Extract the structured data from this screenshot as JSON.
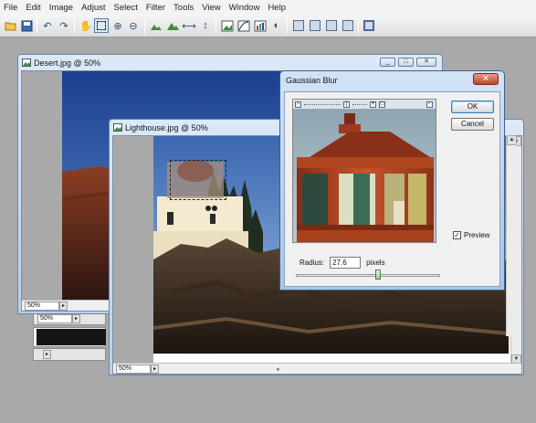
{
  "menu": [
    "File",
    "Edit",
    "Image",
    "Adjust",
    "Select",
    "Filter",
    "Tools",
    "View",
    "Window",
    "Help"
  ],
  "toolbar": {
    "icons": [
      "open-icon",
      "save-icon",
      "undo-icon",
      "redo-icon",
      "hand-tool-icon",
      "marquee-tool-icon",
      "zoom-in-icon",
      "zoom-out-icon",
      "mountain-small-icon",
      "mountain-large-icon",
      "flip-horizontal-icon",
      "flip-vertical-icon",
      "image-adjust-icon",
      "curves-icon",
      "levels-icon",
      "color-balance-icon",
      "frame-1-icon",
      "frame-2-icon",
      "frame-3-icon",
      "frame-4-icon",
      "frame-5-icon"
    ]
  },
  "windows": {
    "desert": {
      "title": "Desert.jpg @ 50%",
      "zoom": "50%"
    },
    "lighthouse": {
      "title": "Lighthouse.jpg @ 50%",
      "zoom": "50%"
    },
    "minimized_1": {
      "zoom": "50%"
    }
  },
  "dialog": {
    "title": "Gaussian Blur",
    "close": "✕",
    "ok_label": "OK",
    "cancel_label": "Cancel",
    "preview_label": "Preview",
    "preview_checked": true,
    "radius_label": "Radius:",
    "radius_value": "27.6",
    "radius_units": "pixels",
    "radius_slider_fraction": 0.57
  },
  "colors": {
    "accent": "#3c7fb1",
    "titlebar_top": "#dce9f7",
    "titlebar_bottom": "#b9d0ea",
    "close_red": "#c0422a"
  }
}
